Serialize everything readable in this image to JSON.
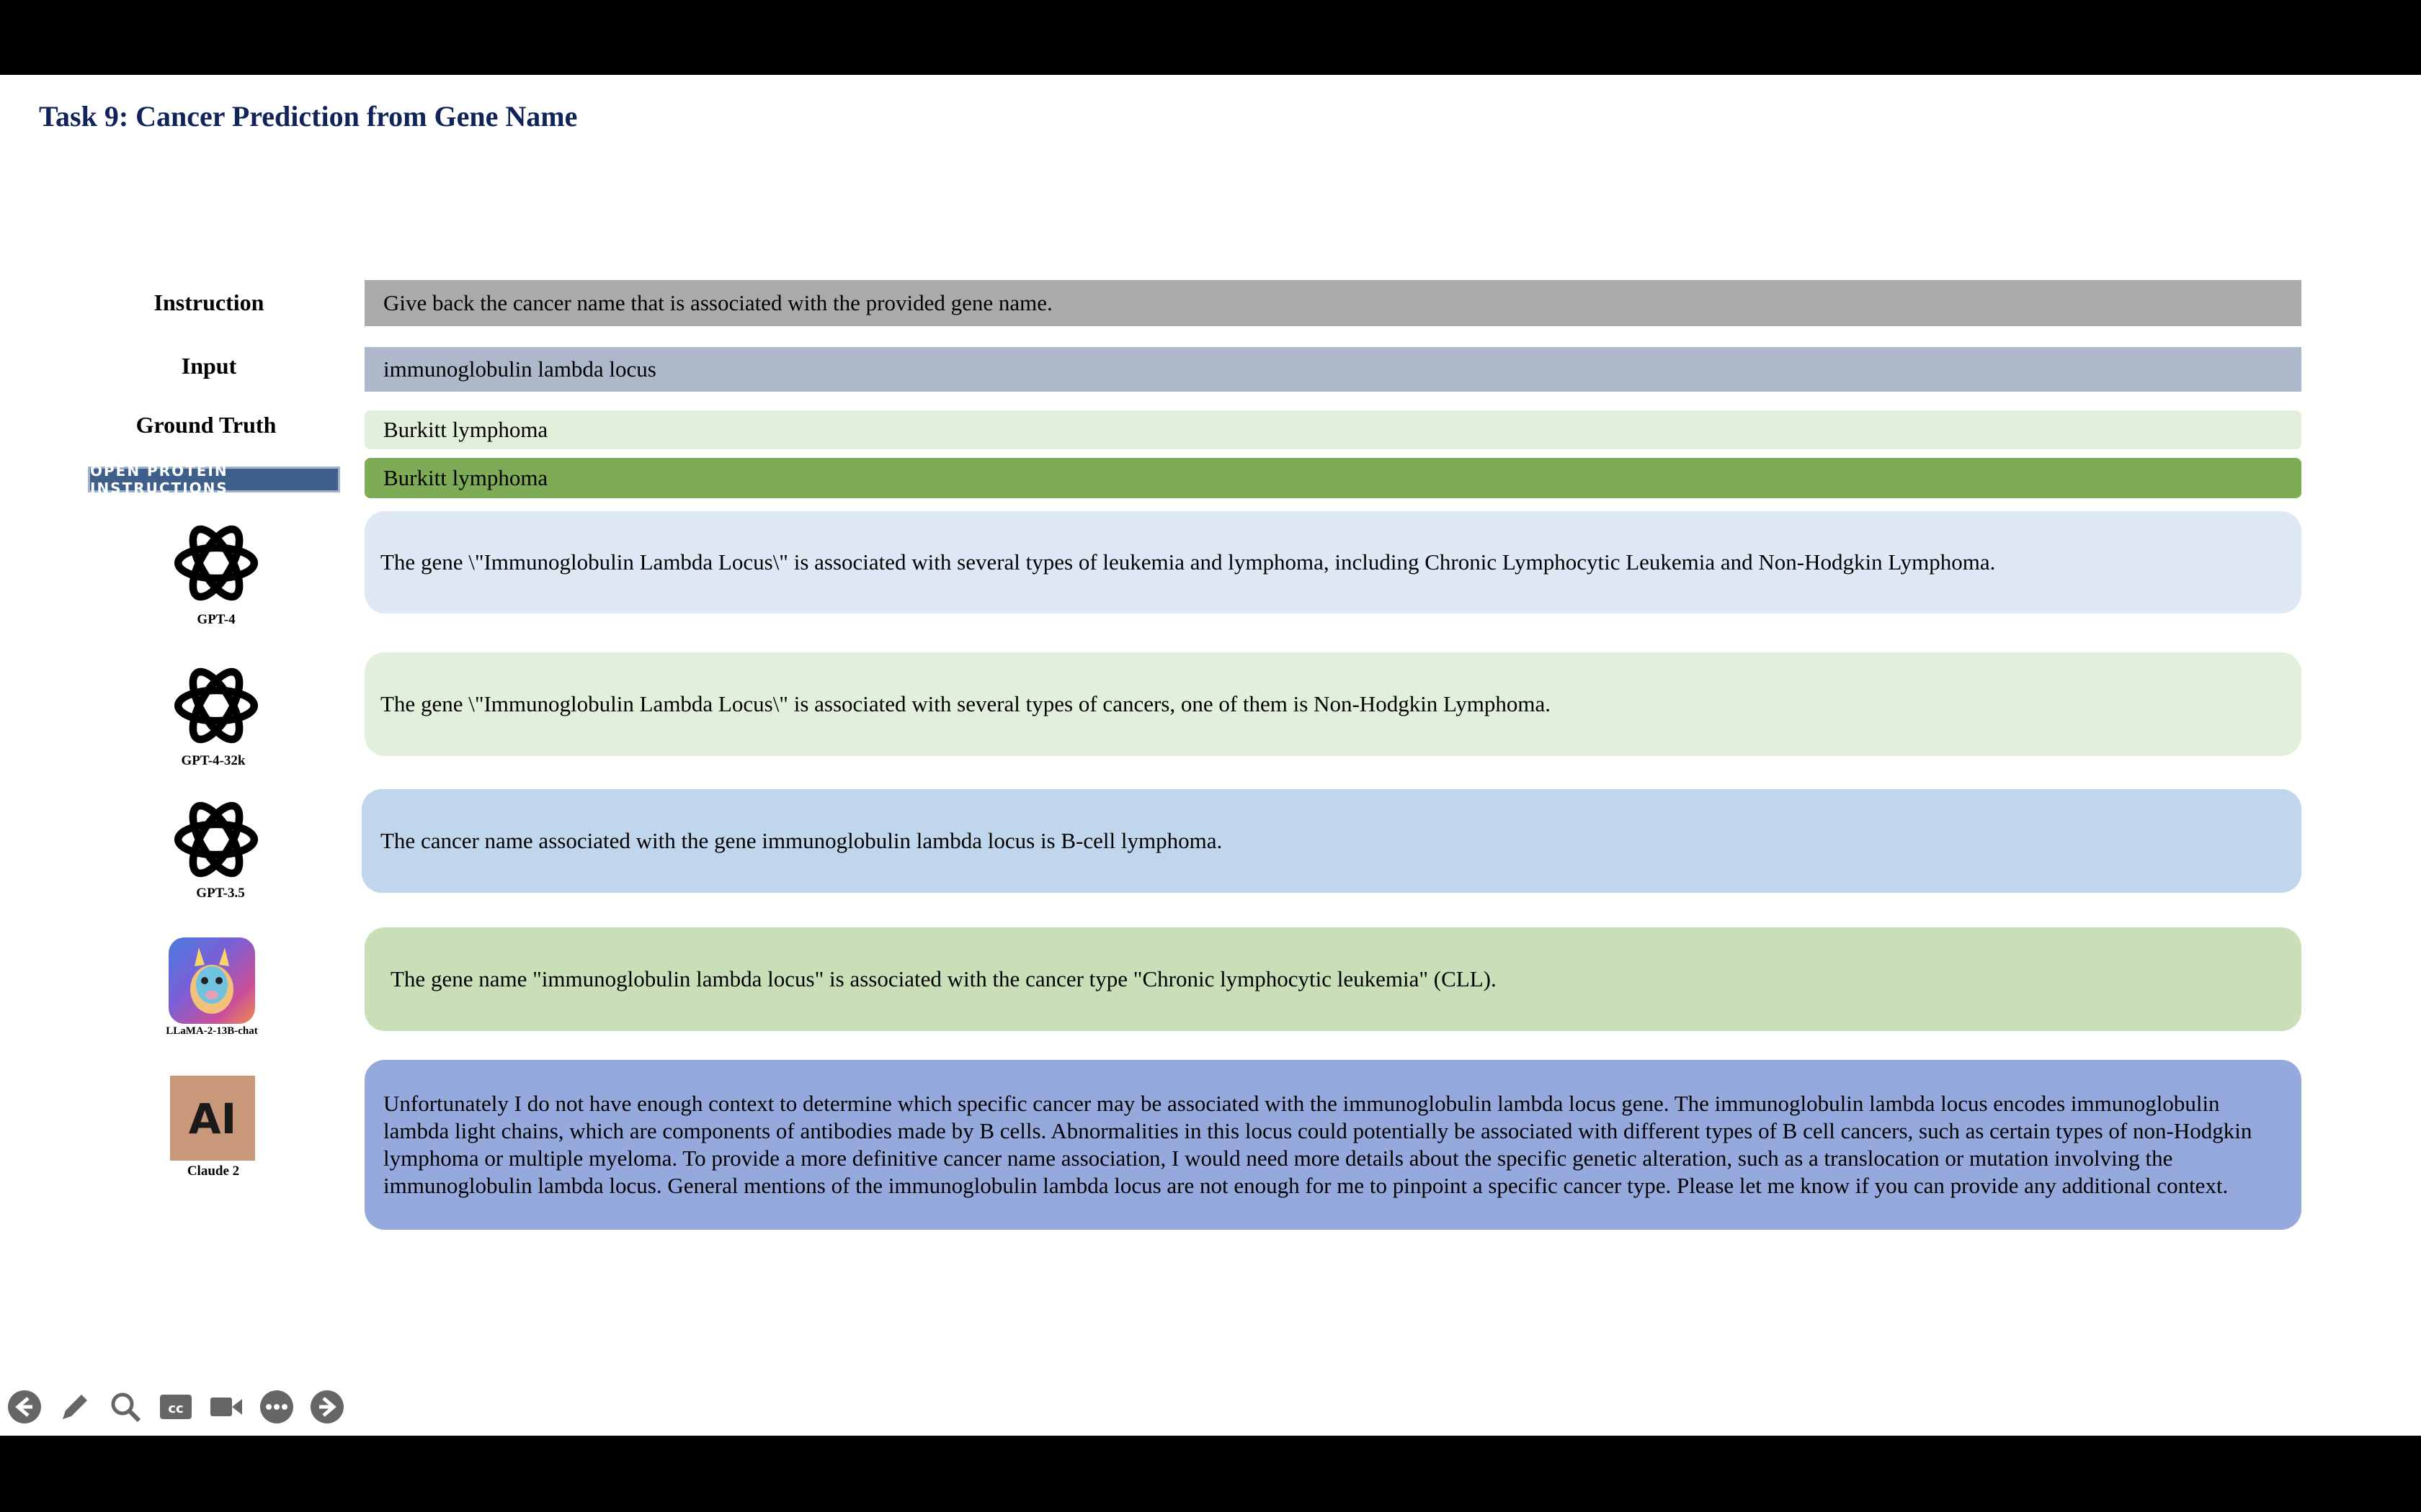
{
  "slide": {
    "title": "Task 9: Cancer Prediction from Gene Name"
  },
  "rows": {
    "instruction": {
      "label": "Instruction",
      "text": "Give back the cancer name that is associated with the provided gene name."
    },
    "input": {
      "label": "Input",
      "text": "immunoglobulin lambda locus"
    },
    "ground_truth": {
      "label": "Ground Truth",
      "text": "Burkitt lymphoma"
    },
    "opi": {
      "logo": "OPEN PROTEIN INSTRUCTIONS",
      "text": "Burkitt lymphoma"
    }
  },
  "models": {
    "gpt4": {
      "name": "GPT-4",
      "text": "The gene \\\"Immunoglobulin Lambda Locus\\\" is associated with several types of leukemia and lymphoma, including Chronic Lymphocytic Leukemia and Non-Hodgkin Lymphoma."
    },
    "gpt4_32k": {
      "name": "GPT-4-32k",
      "text": "The gene \\\"Immunoglobulin Lambda Locus\\\" is associated with several types of cancers, one of them is Non-Hodgkin Lymphoma."
    },
    "gpt35": {
      "name": "GPT-3.5",
      "text": "The cancer name associated with the gene immunoglobulin lambda locus is B-cell lymphoma."
    },
    "llama": {
      "name": "LLaMA-2-13B-chat",
      "text": "The gene name \"immunoglobulin lambda locus\" is associated with the cancer type \"Chronic lymphocytic leukemia\" (CLL)."
    },
    "claude": {
      "name": "Claude 2",
      "logo": "AI",
      "text": "Unfortunately I do not have enough context to determine which specific cancer may be associated with the immunoglobulin lambda locus gene. The immunoglobulin lambda locus encodes immunoglobulin lambda light chains, which are components of antibodies made by B cells. Abnormalities in this locus could potentially be associated with different types of B cell cancers, such as certain types of non-Hodgkin lymphoma or multiple myeloma. To provide a more definitive cancer name association, I would need more details about the specific genetic alteration, such as a translocation or mutation involving the immunoglobulin lambda locus. General mentions of the immunoglobulin lambda locus are not enough for me to pinpoint a specific cancer type. Please let me know if you can provide any additional context."
    }
  },
  "colors": {
    "instruction_bg": "#aaaaaa",
    "input_bg": "#adb9ca",
    "ground_truth_bg": "#e2efda",
    "opi_bg": "#7eab55",
    "gpt4_bg": "#dee9f5",
    "gpt4_32k_bg": "#e2efda",
    "gpt35_bg": "#c0d6ec",
    "llama_bg": "#c9dfb8",
    "claude_bg": "#96a9dc",
    "title": "#10245a"
  },
  "toolbar": {
    "icons": [
      "back-arrow-icon",
      "pen-icon",
      "zoom-icon",
      "captions-icon",
      "video-icon",
      "more-icon",
      "forward-arrow-icon"
    ]
  }
}
